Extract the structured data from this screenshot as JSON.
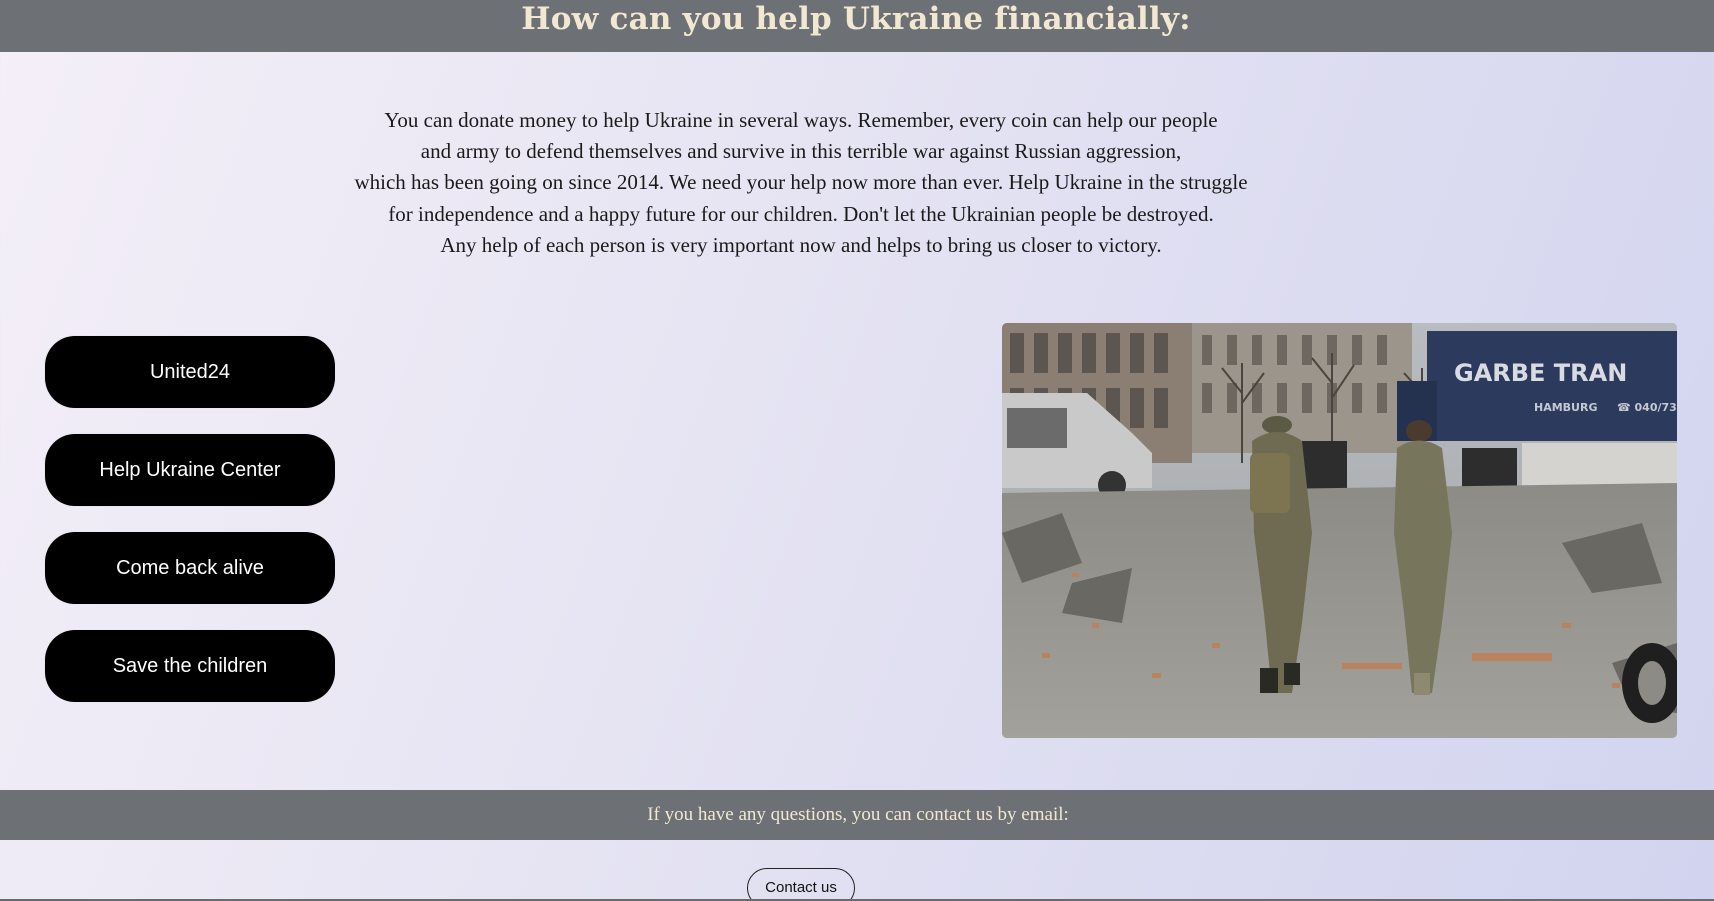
{
  "header": {
    "title": "How can you help Ukraine financially:"
  },
  "intro": {
    "lines": [
      "You can donate money to help Ukraine in several ways. Remember, every coin can help our people",
      "and army to defend themselves and survive in this terrible war against Russian aggression,",
      "which has been going on since 2014. We need your help now more than ever. Help Ukraine in the struggle",
      "for independence and a happy future for our children. Don't let the Ukrainian people be destroyed.",
      "Any help of each person is very important now and helps to bring us closer to victory."
    ]
  },
  "donate_buttons": [
    {
      "label": "United24"
    },
    {
      "label": "Help Ukraine Center"
    },
    {
      "label": "Come back alive"
    },
    {
      "label": "Save the children"
    }
  ],
  "photo": {
    "truck_text": "GARBE TRAN",
    "truck_subtext": "HAMBURG",
    "truck_phone": "☎ 040/73"
  },
  "footer": {
    "contact_text": "If you have any questions, you can contact us by email:",
    "contact_button": "Contact us"
  },
  "colors": {
    "header_bg": "#6d7075",
    "header_text": "#f2e8d2",
    "button_bg": "#000000",
    "button_text": "#ffffff"
  }
}
